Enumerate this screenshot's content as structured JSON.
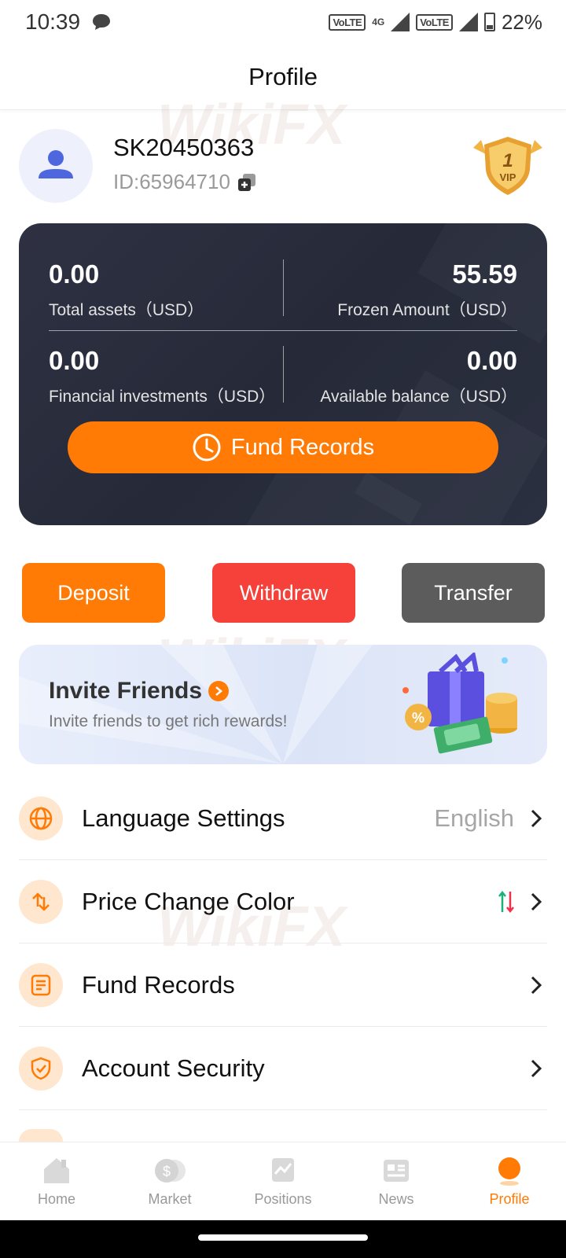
{
  "status_bar": {
    "time": "10:39",
    "volte1": "VoLTE",
    "network": "4G",
    "volte2": "VoLTE",
    "battery": "22%"
  },
  "header": {
    "title": "Profile"
  },
  "user": {
    "name": "SK20450363",
    "id": "ID:65964710",
    "vip_level": "1",
    "vip_label": "VIP"
  },
  "assets": {
    "total_assets": {
      "value": "0.00",
      "label": "Total assets（USD）"
    },
    "frozen_amount": {
      "value": "55.59",
      "label": "Frozen Amount（USD）"
    },
    "financial_investments": {
      "value": "0.00",
      "label": "Financial investments（USD）"
    },
    "available_balance": {
      "value": "0.00",
      "label": "Available balance（USD）"
    },
    "fund_records_label": "Fund Records"
  },
  "actions": {
    "deposit": "Deposit",
    "withdraw": "Withdraw",
    "transfer": "Transfer"
  },
  "invite": {
    "title": "Invite Friends",
    "subtitle": "Invite friends to get rich rewards!"
  },
  "settings": {
    "language": {
      "label": "Language Settings",
      "value": "English"
    },
    "price_color": {
      "label": "Price Change Color"
    },
    "fund_records": {
      "label": "Fund Records"
    },
    "account_security": {
      "label": "Account Security"
    }
  },
  "nav": {
    "home": "Home",
    "market": "Market",
    "positions": "Positions",
    "news": "News",
    "profile": "Profile"
  },
  "watermark": "WikiFX",
  "colors": {
    "accent": "#ff7b05",
    "withdraw": "#f5413a",
    "transfer": "#5c5c5c",
    "card": "#2a2e3c"
  }
}
